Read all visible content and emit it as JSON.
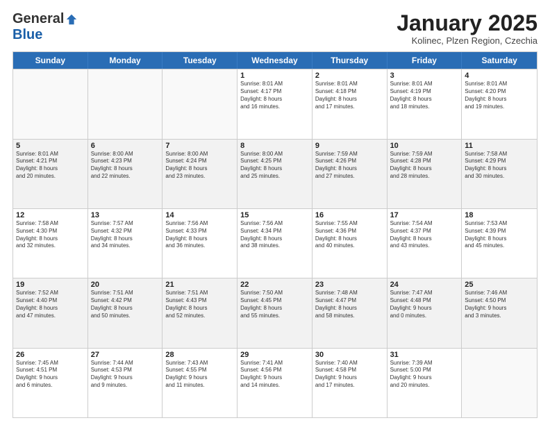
{
  "logo": {
    "general": "General",
    "blue": "Blue"
  },
  "title": "January 2025",
  "subtitle": "Kolinec, Plzen Region, Czechia",
  "days": [
    "Sunday",
    "Monday",
    "Tuesday",
    "Wednesday",
    "Thursday",
    "Friday",
    "Saturday"
  ],
  "weeks": [
    [
      {
        "day": "",
        "info": ""
      },
      {
        "day": "",
        "info": ""
      },
      {
        "day": "",
        "info": ""
      },
      {
        "day": "1",
        "info": "Sunrise: 8:01 AM\nSunset: 4:17 PM\nDaylight: 8 hours\nand 16 minutes."
      },
      {
        "day": "2",
        "info": "Sunrise: 8:01 AM\nSunset: 4:18 PM\nDaylight: 8 hours\nand 17 minutes."
      },
      {
        "day": "3",
        "info": "Sunrise: 8:01 AM\nSunset: 4:19 PM\nDaylight: 8 hours\nand 18 minutes."
      },
      {
        "day": "4",
        "info": "Sunrise: 8:01 AM\nSunset: 4:20 PM\nDaylight: 8 hours\nand 19 minutes."
      }
    ],
    [
      {
        "day": "5",
        "info": "Sunrise: 8:01 AM\nSunset: 4:21 PM\nDaylight: 8 hours\nand 20 minutes."
      },
      {
        "day": "6",
        "info": "Sunrise: 8:00 AM\nSunset: 4:23 PM\nDaylight: 8 hours\nand 22 minutes."
      },
      {
        "day": "7",
        "info": "Sunrise: 8:00 AM\nSunset: 4:24 PM\nDaylight: 8 hours\nand 23 minutes."
      },
      {
        "day": "8",
        "info": "Sunrise: 8:00 AM\nSunset: 4:25 PM\nDaylight: 8 hours\nand 25 minutes."
      },
      {
        "day": "9",
        "info": "Sunrise: 7:59 AM\nSunset: 4:26 PM\nDaylight: 8 hours\nand 27 minutes."
      },
      {
        "day": "10",
        "info": "Sunrise: 7:59 AM\nSunset: 4:28 PM\nDaylight: 8 hours\nand 28 minutes."
      },
      {
        "day": "11",
        "info": "Sunrise: 7:58 AM\nSunset: 4:29 PM\nDaylight: 8 hours\nand 30 minutes."
      }
    ],
    [
      {
        "day": "12",
        "info": "Sunrise: 7:58 AM\nSunset: 4:30 PM\nDaylight: 8 hours\nand 32 minutes."
      },
      {
        "day": "13",
        "info": "Sunrise: 7:57 AM\nSunset: 4:32 PM\nDaylight: 8 hours\nand 34 minutes."
      },
      {
        "day": "14",
        "info": "Sunrise: 7:56 AM\nSunset: 4:33 PM\nDaylight: 8 hours\nand 36 minutes."
      },
      {
        "day": "15",
        "info": "Sunrise: 7:56 AM\nSunset: 4:34 PM\nDaylight: 8 hours\nand 38 minutes."
      },
      {
        "day": "16",
        "info": "Sunrise: 7:55 AM\nSunset: 4:36 PM\nDaylight: 8 hours\nand 40 minutes."
      },
      {
        "day": "17",
        "info": "Sunrise: 7:54 AM\nSunset: 4:37 PM\nDaylight: 8 hours\nand 43 minutes."
      },
      {
        "day": "18",
        "info": "Sunrise: 7:53 AM\nSunset: 4:39 PM\nDaylight: 8 hours\nand 45 minutes."
      }
    ],
    [
      {
        "day": "19",
        "info": "Sunrise: 7:52 AM\nSunset: 4:40 PM\nDaylight: 8 hours\nand 47 minutes."
      },
      {
        "day": "20",
        "info": "Sunrise: 7:51 AM\nSunset: 4:42 PM\nDaylight: 8 hours\nand 50 minutes."
      },
      {
        "day": "21",
        "info": "Sunrise: 7:51 AM\nSunset: 4:43 PM\nDaylight: 8 hours\nand 52 minutes."
      },
      {
        "day": "22",
        "info": "Sunrise: 7:50 AM\nSunset: 4:45 PM\nDaylight: 8 hours\nand 55 minutes."
      },
      {
        "day": "23",
        "info": "Sunrise: 7:48 AM\nSunset: 4:47 PM\nDaylight: 8 hours\nand 58 minutes."
      },
      {
        "day": "24",
        "info": "Sunrise: 7:47 AM\nSunset: 4:48 PM\nDaylight: 9 hours\nand 0 minutes."
      },
      {
        "day": "25",
        "info": "Sunrise: 7:46 AM\nSunset: 4:50 PM\nDaylight: 9 hours\nand 3 minutes."
      }
    ],
    [
      {
        "day": "26",
        "info": "Sunrise: 7:45 AM\nSunset: 4:51 PM\nDaylight: 9 hours\nand 6 minutes."
      },
      {
        "day": "27",
        "info": "Sunrise: 7:44 AM\nSunset: 4:53 PM\nDaylight: 9 hours\nand 9 minutes."
      },
      {
        "day": "28",
        "info": "Sunrise: 7:43 AM\nSunset: 4:55 PM\nDaylight: 9 hours\nand 11 minutes."
      },
      {
        "day": "29",
        "info": "Sunrise: 7:41 AM\nSunset: 4:56 PM\nDaylight: 9 hours\nand 14 minutes."
      },
      {
        "day": "30",
        "info": "Sunrise: 7:40 AM\nSunset: 4:58 PM\nDaylight: 9 hours\nand 17 minutes."
      },
      {
        "day": "31",
        "info": "Sunrise: 7:39 AM\nSunset: 5:00 PM\nDaylight: 9 hours\nand 20 minutes."
      },
      {
        "day": "",
        "info": ""
      }
    ]
  ]
}
